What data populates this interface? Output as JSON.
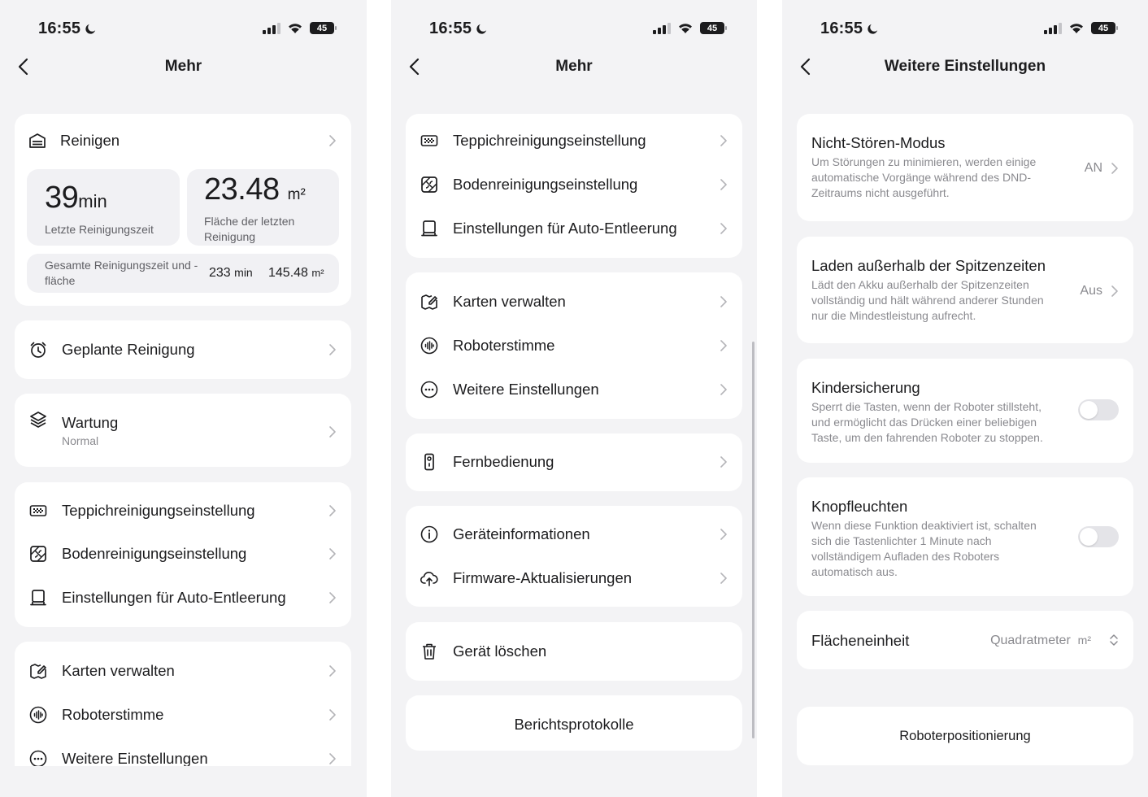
{
  "status_bar": {
    "time": "16:55",
    "battery": "45"
  },
  "screen1": {
    "title": "Mehr",
    "reinigen": {
      "label": "Reinigen",
      "last_time_value": "39",
      "last_time_unit": "min",
      "last_time_caption": "Letzte Reinigungszeit",
      "last_area_value": "23.48",
      "last_area_unit": "m²",
      "last_area_caption": "Fläche der letzten Reinigung",
      "total_caption": "Gesamte Reinigungszeit und -fläche",
      "total_time_value": "233",
      "total_time_unit": "min",
      "total_area_value": "145.48",
      "total_area_unit": "m²"
    },
    "scheduled": "Geplante Reinigung",
    "maintenance": {
      "label": "Wartung",
      "sub": "Normal"
    },
    "group1": [
      "Teppichreinigungseinstellung",
      "Bodenreinigungseinstellung",
      "Einstellungen für Auto-Entleerung"
    ],
    "group2": [
      "Karten verwalten",
      "Roboterstimme",
      "Weitere Einstellungen"
    ]
  },
  "screen2": {
    "title": "Mehr",
    "group1": [
      "Teppichreinigungseinstellung",
      "Bodenreinigungseinstellung",
      "Einstellungen für Auto-Entleerung"
    ],
    "group2": [
      "Karten verwalten",
      "Roboterstimme",
      "Weitere Einstellungen"
    ],
    "remote": "Fernbedienung",
    "group3": [
      "Geräteinformationen",
      "Firmware-Aktualisierungen"
    ],
    "delete": "Gerät löschen",
    "logs": "Berichtsprotokolle"
  },
  "screen3": {
    "title": "Weitere Einstellungen",
    "dnd": {
      "title": "Nicht-Stören-Modus",
      "desc": "Um Störungen zu minimieren, werden einige automatische Vorgänge während des DND-Zeitraums nicht ausgeführt.",
      "value": "AN"
    },
    "offpeak": {
      "title": "Laden außerhalb der Spitzenzeiten",
      "desc": "Lädt den Akku außerhalb der Spitzenzeiten vollständig und hält während anderer Stunden nur die Mindestleistung aufrecht.",
      "value": "Aus"
    },
    "childlock": {
      "title": "Kindersicherung",
      "desc": "Sperrt die Tasten, wenn der Roboter stillsteht, und ermöglicht das Drücken einer beliebigen Taste, um den fahrenden Roboter zu stoppen.",
      "enabled": false
    },
    "buttonlights": {
      "title": "Knopfleuchten",
      "desc": "Wenn diese Funktion deaktiviert ist, schalten sich die Tastenlichter 1 Minute nach vollständigem Aufladen des Roboters automatisch aus.",
      "enabled": false
    },
    "unit": {
      "title": "Flächeneinheit",
      "value": "Quadratmeter",
      "symbol": "m²"
    },
    "positioning": "Roboterpositionierung"
  },
  "colors": {
    "background": "#f3f3f5",
    "card": "#ffffff",
    "text": "#1c1c1e",
    "secondary": "#8a8a8f",
    "toggle_off": "#e4e4e8"
  }
}
